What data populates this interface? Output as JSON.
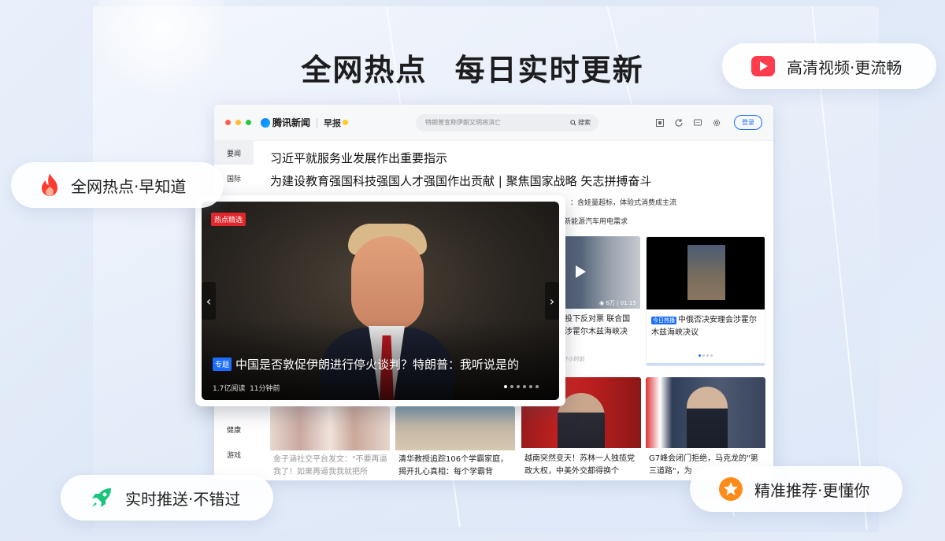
{
  "headline": {
    "part1": "全网热点",
    "part2": "每日实时更新"
  },
  "badges": {
    "hd_video": "高清视频·更流畅",
    "hot": "全网热点·早知道",
    "push": "实时推送·不错过",
    "recommend": "精准推荐·更懂你"
  },
  "browser": {
    "logo": "腾讯新闻",
    "zaobao": "早报",
    "search_placeholder": "特朗普宣称伊朗又明将消亡",
    "search_button": "搜索",
    "login": "登录"
  },
  "sidebar": {
    "items": [
      {
        "label": "要闻"
      },
      {
        "label": "国际"
      },
      {
        "label": "健康"
      },
      {
        "label": "游戏"
      }
    ]
  },
  "news": {
    "headline1": "习近平就服务业发展作出重要指示",
    "headline2": "为建设教育强国科技强国人才强国作出贡献 | 聚焦国家战略 矢志拼搏奋斗",
    "sub1": "：含娃量超标，体验式消费成主流",
    "sub2": "新能源汽车用电需求"
  },
  "cards": {
    "un_vote": {
      "text": "投下反对票 联合国涉霍尔木兹海峡决",
      "views": "6万",
      "duration": "01:15",
      "time": "7小时前"
    },
    "security_council": {
      "tag": "今日热播",
      "text": "中俄否决安理会涉霍尔木兹海峡决议"
    },
    "jin_ziduo": {
      "text": "金子涵社交平台发文：\"不要再逼我了！如果再逼我我就把所"
    },
    "tsinghua": {
      "text": "清华教授追踪106个学霸家庭，揭开扎心真相：每个学霸背"
    },
    "vietnam": {
      "text": "越南突然变天！苏林一人独揽党政大权，中美外交都得换个"
    },
    "g7": {
      "text": "G7峰会闭门拒绝，马克龙的\"第三道路\"，为"
    }
  },
  "popup": {
    "tag": "热点精选",
    "topic_tag": "专题",
    "title": "中国是否敦促伊朗进行停火谈判？特朗普：我听说是的",
    "reads": "1.7亿阅读",
    "time": "11分钟前"
  },
  "colors": {
    "accent": "#1a6dff",
    "red": "#e1262c"
  }
}
